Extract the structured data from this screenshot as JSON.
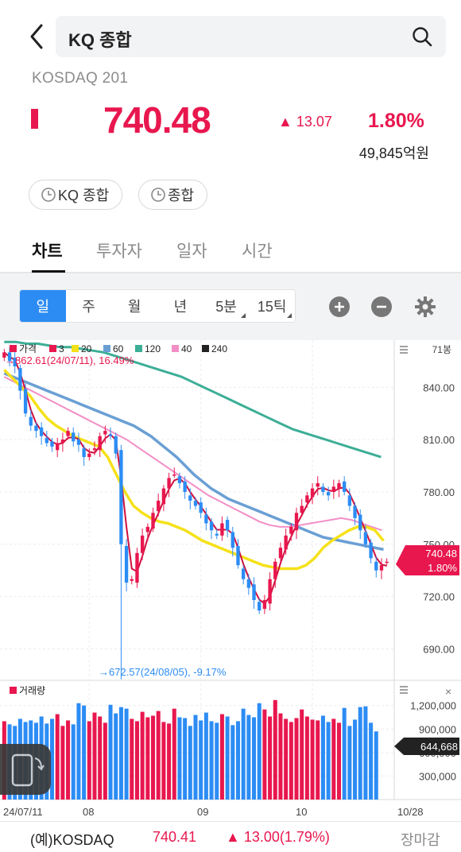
{
  "search": {
    "query": "KQ 종합"
  },
  "header": {
    "index_name": "KOSDAQ 201",
    "price": "740.48",
    "change": "13.07",
    "change_pct": "1.80%",
    "amount": "49,845억원"
  },
  "chips": [
    {
      "label": "KQ 종합"
    },
    {
      "label": "종합"
    }
  ],
  "tabs": [
    {
      "label": "차트",
      "active": true
    },
    {
      "label": "투자자"
    },
    {
      "label": "일자"
    },
    {
      "label": "시간"
    }
  ],
  "periods": [
    {
      "label": "일",
      "active": true
    },
    {
      "label": "주"
    },
    {
      "label": "월"
    },
    {
      "label": "년"
    },
    {
      "label": "5분"
    },
    {
      "label": "15틱"
    }
  ],
  "legend": {
    "items": [
      {
        "label": "가격",
        "color": "#e8174e"
      },
      {
        "label": "3",
        "color": "#e8174e"
      },
      {
        "label": "20",
        "color": "#f5e11a"
      },
      {
        "label": "60",
        "color": "#6a9fd4"
      },
      {
        "label": "120",
        "color": "#3cae96"
      },
      {
        "label": "40",
        "color": "#f28ec6"
      },
      {
        "label": "240",
        "color": "#222222"
      }
    ],
    "bong_label": "71봉"
  },
  "annotations": {
    "high": "→862.61(24/07/11), 16.49%",
    "low": "→672.57(24/08/05), -9.17%"
  },
  "price_tag": {
    "price": "740.48",
    "pct": "1.80%"
  },
  "volume": {
    "label": "거래량",
    "current": "644,668"
  },
  "chart_data": {
    "type": "candlestick",
    "y_ticks": [
      "840.00",
      "810.00",
      "780.00",
      "750.00",
      "720.00",
      "690.00"
    ],
    "y_tick_values": [
      840,
      810,
      780,
      750,
      720,
      690
    ],
    "ylim": [
      672,
      867
    ],
    "x_tick_labels": [
      "24/07/11",
      "08",
      "09",
      "10",
      "10/28"
    ],
    "volume_ticks": [
      "1,200,000",
      "900,000",
      "600,000",
      "300,000"
    ],
    "volume_tick_values": [
      1200000,
      900000,
      600000,
      300000
    ],
    "volume_ylim": [
      0,
      1400000
    ],
    "close": [
      860,
      855,
      852,
      838,
      825,
      818,
      815,
      812,
      808,
      806,
      808,
      810,
      815,
      809,
      807,
      800,
      802,
      805,
      812,
      815,
      812,
      802,
      750,
      728,
      730,
      745,
      755,
      760,
      768,
      775,
      782,
      788,
      790,
      785,
      780,
      775,
      772,
      768,
      762,
      758,
      755,
      762,
      758,
      748,
      738,
      730,
      725,
      718,
      712,
      718,
      730,
      740,
      748,
      755,
      760,
      768,
      772,
      778,
      782,
      785,
      780,
      778,
      783,
      785,
      780,
      772,
      765,
      758,
      750,
      742,
      735,
      738,
      740
    ],
    "ma20": [
      850,
      845,
      840,
      835,
      828,
      822,
      818,
      815,
      812,
      810,
      808,
      806,
      800,
      790,
      780,
      772,
      768,
      765,
      763,
      762,
      760,
      758,
      755,
      752,
      750,
      748,
      746,
      744,
      742,
      740,
      738,
      737,
      736,
      736,
      736,
      738,
      742,
      748,
      752,
      755,
      758,
      760,
      760,
      758,
      752
    ],
    "ma60": [
      848,
      846,
      844,
      842,
      840,
      838,
      836,
      834,
      832,
      830,
      828,
      826,
      824,
      822,
      820,
      818,
      815,
      812,
      808,
      804,
      800,
      795,
      790,
      786,
      782,
      779,
      776,
      774,
      772,
      770,
      768,
      766,
      764,
      762,
      760,
      758,
      756,
      754,
      753,
      752,
      751,
      750,
      749,
      748,
      747
    ],
    "ma120": [
      866,
      866,
      865,
      865,
      864,
      863,
      863,
      862,
      861,
      860,
      858,
      856,
      854,
      852,
      850,
      848,
      846,
      843,
      840,
      837,
      834,
      831,
      828,
      825,
      822,
      819,
      816,
      814,
      812,
      810,
      808,
      806,
      804,
      802,
      800
    ],
    "ma40": [
      846,
      843,
      840,
      837,
      834,
      831,
      828,
      825,
      822,
      819,
      816,
      813,
      810,
      806,
      802,
      798,
      794,
      790,
      786,
      782,
      778,
      775,
      772,
      769,
      766,
      763,
      761,
      760,
      760,
      761,
      762,
      763,
      764,
      765,
      764,
      762,
      760,
      758
    ],
    "volume": [
      1000000,
      960000,
      940000,
      1030000,
      990000,
      1010000,
      980000,
      1060000,
      970000,
      1030000,
      1090000,
      940000,
      1010000,
      960000,
      1230000,
      1200000,
      1000000,
      1110000,
      1060000,
      980000,
      1210000,
      1100000,
      1180000,
      1160000,
      1030000,
      1000000,
      1120000,
      1050000,
      1070000,
      1130000,
      990000,
      970000,
      1160000,
      1050000,
      1040000,
      940000,
      1080000,
      1010000,
      1110000,
      1000000,
      980000,
      1090000,
      1060000,
      950000,
      1000000,
      1160000,
      1080000,
      1050000,
      1230000,
      1150000,
      1060000,
      1270000,
      1100000,
      1030000,
      990000,
      1040000,
      1150000,
      1060000,
      1020000,
      1010000,
      1070000,
      990000,
      1030000,
      980000,
      1170000,
      940000,
      1020000,
      1180000,
      1190000,
      980000,
      870000
    ]
  },
  "bottom": {
    "name": "(예)KOSDAQ",
    "price": "740.41",
    "change": "▲ 13.00(1.79%)",
    "status": "장마감"
  }
}
